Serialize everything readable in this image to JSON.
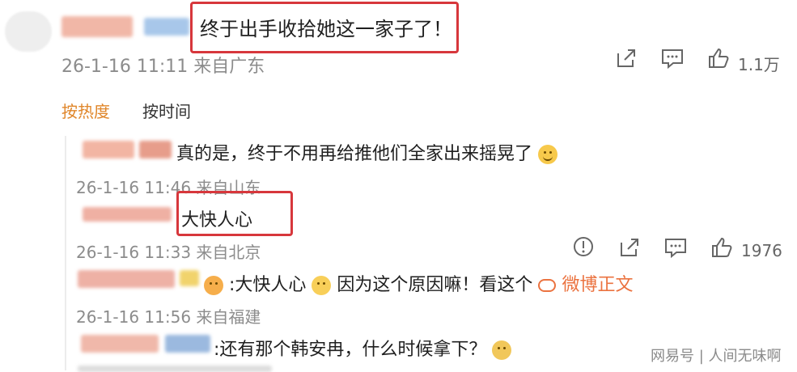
{
  "post": {
    "text": "终于出手收拾她这一家子了！",
    "meta": "26-1-16 11:11 来自广东",
    "like_count": "1.1万"
  },
  "sort_tabs": [
    {
      "label": "按热度",
      "active": true
    },
    {
      "label": "按时间",
      "active": false
    }
  ],
  "comments": [
    {
      "text": "真的是，终于不用再给推他们全家出来摇晃了",
      "meta": "26-1-16 11:46 来自山东"
    },
    {
      "text": "大快人心",
      "meta": "26-1-16 11:33 来自北京",
      "like_count": "1976"
    },
    {
      "text_prefix": ":大快人心",
      "text_middle": "因为这个原因嘛！看这个",
      "link": "微博正文",
      "meta": "26-1-16 11:56 来自福建"
    },
    {
      "text": ":还有那个韩安冉，什么时候拿下？"
    }
  ],
  "watermark": {
    "brand": "网易号",
    "author": "人间无味啊"
  },
  "colors": {
    "highlight_box": "#d7373c",
    "active_tab": "#e0862a",
    "link": "#eb7340"
  },
  "icons": [
    "share-icon",
    "comment-icon",
    "like-icon",
    "report-icon",
    "emoji-smile",
    "emoji-cat"
  ]
}
